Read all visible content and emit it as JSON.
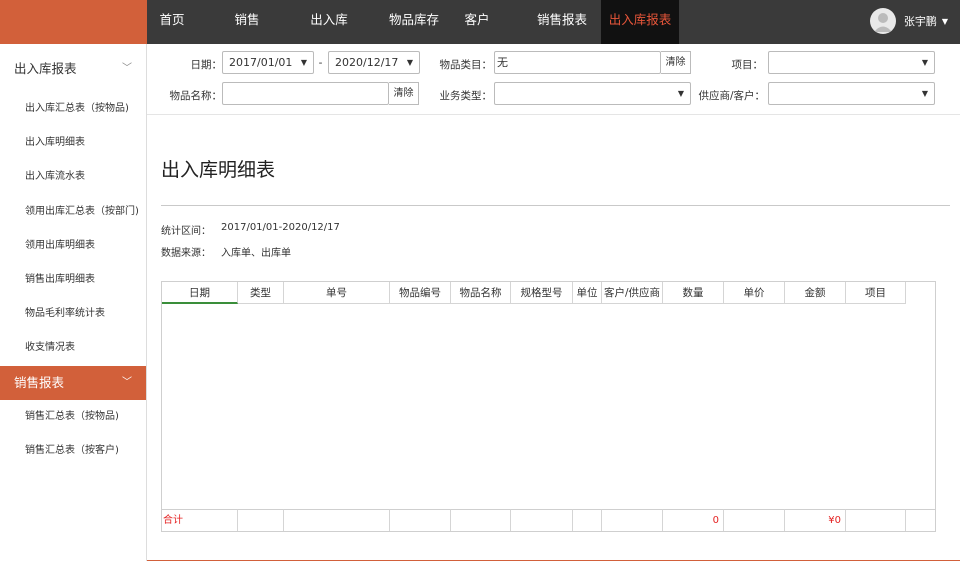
{
  "topnav": {
    "items": [
      {
        "label": "首页"
      },
      {
        "label": "销售"
      },
      {
        "label": "出入库"
      },
      {
        "label": "物品库存"
      },
      {
        "label": "客户"
      },
      {
        "label": "销售报表"
      },
      {
        "label": "出入库报表",
        "active": true
      }
    ],
    "user_name": "张宇鹏",
    "active_color": "#e8563a"
  },
  "sidebar": {
    "section1": {
      "label": "出入库报表",
      "items": [
        "出入库汇总表（按物品)",
        "出入库明细表",
        "出入库流水表",
        "领用出库汇总表（按部门)",
        "领用出库明细表",
        "销售出库明细表",
        "物品毛利率统计表",
        "收支情况表"
      ]
    },
    "section2": {
      "label": "销售报表",
      "items": [
        "销售汇总表（按物品)",
        "销售汇总表（按客户)"
      ]
    },
    "accent_color": "#d2603a"
  },
  "filters": {
    "date_label": "日期：",
    "date_from": "2017/01/01",
    "date_sep": "-",
    "date_to": "2020/12/17",
    "category_label": "物品类目：",
    "category_value": "无",
    "clear_label": "清除",
    "project_label": "项目：",
    "project_value": "",
    "item_name_label": "物品名称：",
    "item_name_value": "",
    "biz_type_label": "业务类型：",
    "biz_type_value": "",
    "supplier_label": "供应商/客户：",
    "supplier_value": ""
  },
  "report": {
    "title": "出入库明细表",
    "period_label": "统计区间：",
    "period_value": "2017/01/01-2020/12/17",
    "source_label": "数据来源：",
    "source_value": "入库单、出库单"
  },
  "table": {
    "headers": [
      "日期",
      "类型",
      "单号",
      "物品编号",
      "物品名称",
      "规格型号",
      "单位",
      "客户/供应商",
      "数量",
      "单价",
      "金额",
      "项目"
    ],
    "rows": [],
    "footer": {
      "label": "合计",
      "quantity_total": "0",
      "amount_total": "¥0"
    },
    "total_color": "#e52222",
    "sort_indicator_color": "#3a8e3a"
  }
}
